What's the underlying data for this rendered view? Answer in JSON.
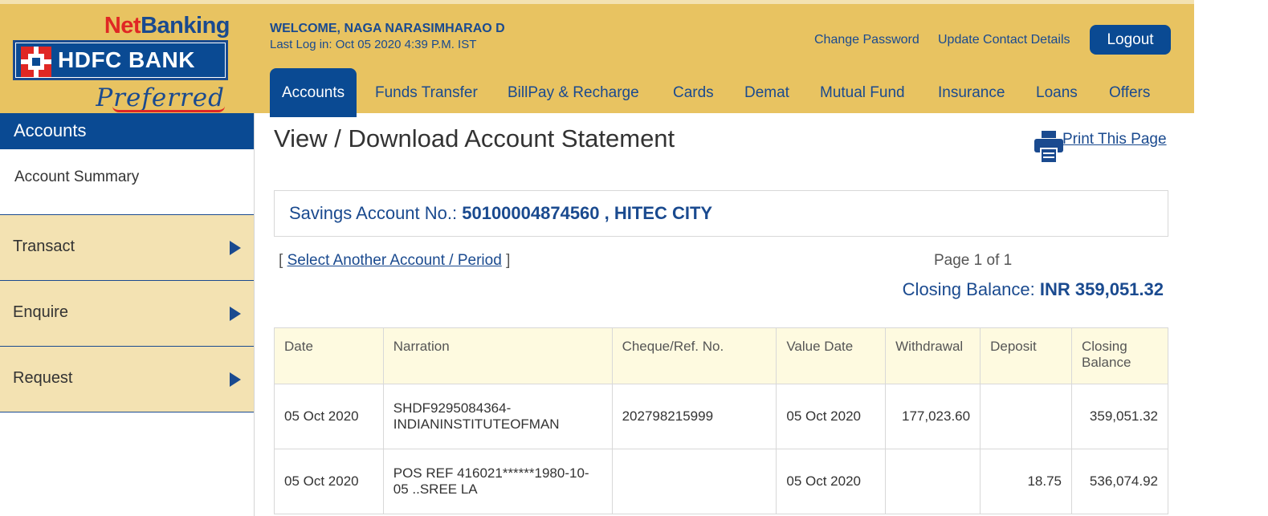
{
  "brand": {
    "netbanking_net": "Net",
    "netbanking_banking": "Banking",
    "bank_name": "HDFC BANK",
    "tier": "Preferred"
  },
  "header": {
    "welcome": "WELCOME, NAGA NARASIMHARAO D",
    "last_login": "Last Log in: Oct 05 2020 4:39 P.M. IST",
    "change_password": "Change Password",
    "update_contact": "Update Contact Details",
    "logout": "Logout"
  },
  "nav": {
    "items": [
      "Accounts",
      "Funds Transfer",
      "BillPay & Recharge",
      "Cards",
      "Demat",
      "Mutual Fund",
      "Insurance",
      "Loans",
      "Offers"
    ],
    "active": "Accounts"
  },
  "sidebar": {
    "heading": "Accounts",
    "summary": "Account Summary",
    "items": [
      {
        "label": "Transact",
        "icon": "triangle-right-icon"
      },
      {
        "label": "Enquire",
        "icon": "triangle-right-icon"
      },
      {
        "label": "Request",
        "icon": "triangle-right-icon"
      }
    ]
  },
  "main": {
    "title": "View / Download Account Statement",
    "print_label": "Print This Page",
    "account_prefix": "Savings Account No.: ",
    "account_value": "50100004874560 , HITEC CITY",
    "select_open": "[ ",
    "select_link": "Select Another Account / Period",
    "select_close": " ]",
    "page_info": "Page 1 of 1",
    "closing_prefix": "Closing Balance: ",
    "closing_value": "INR 359,051.32"
  },
  "table": {
    "headers": [
      "Date",
      "Narration",
      "Cheque/Ref. No.",
      "Value Date",
      "Withdrawal",
      "Deposit",
      "Closing Balance"
    ],
    "rows": [
      {
        "date": "05 Oct 2020",
        "narration": "SHDF9295084364-INDIANINSTITUTEOFMAN",
        "ref": "202798215999",
        "value_date": "05 Oct 2020",
        "withdrawal": "177,023.60",
        "deposit": "",
        "balance": "359,051.32"
      },
      {
        "date": "05 Oct 2020",
        "narration": "POS REF 416021******1980-10-05 ..SREE LA",
        "ref": "",
        "value_date": "05 Oct 2020",
        "withdrawal": "",
        "deposit": "18.75",
        "balance": "536,074.92"
      }
    ]
  },
  "colors": {
    "header_gold": "#e8c361",
    "brand_blue": "#0a4a93",
    "brand_red": "#e02724",
    "sidebar_item_bg": "#f3e2b2",
    "table_header_bg": "#fefae0"
  }
}
